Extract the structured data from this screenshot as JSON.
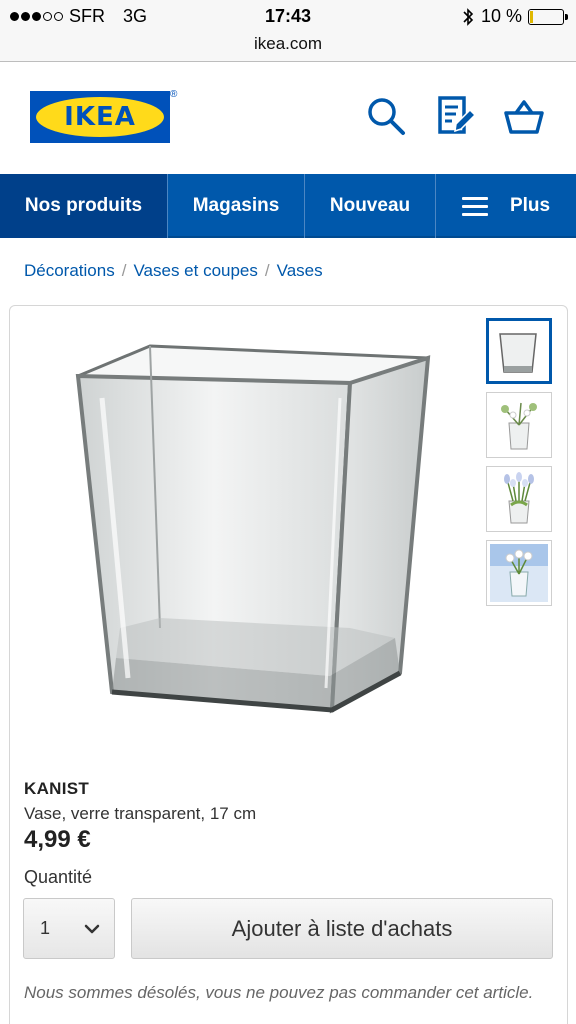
{
  "status_bar": {
    "carrier": "SFR",
    "network": "3G",
    "time": "17:43",
    "battery": "10 %",
    "battery_level": 0.1,
    "signal_bars": 3,
    "signal_total": 5
  },
  "browser": {
    "url": "ikea.com"
  },
  "header": {
    "logo_text": "IKEA",
    "logo_reg": "®",
    "icons": [
      "search-icon",
      "shopping-list-icon",
      "cart-icon"
    ]
  },
  "nav": {
    "items": [
      {
        "label": "Nos produits"
      },
      {
        "label": "Magasins"
      },
      {
        "label": "Nouveau"
      },
      {
        "label": "Plus"
      }
    ]
  },
  "breadcrumb": {
    "items": [
      "Décorations",
      "Vases et coupes",
      "Vases"
    ],
    "separator": "/"
  },
  "product": {
    "name": "KANIST",
    "description": "Vase, verre transparent, 17 cm",
    "price": "4,99 €",
    "quantity_label": "Quantité",
    "quantity_value": "1",
    "add_button": "Ajouter à liste d'achats",
    "notice": "Nous sommes désolés, vous ne pouvez pas commander cet article."
  },
  "colors": {
    "brand_blue": "#0051ba",
    "brand_yellow": "#ffda1a",
    "nav_blue": "#0058ab"
  }
}
